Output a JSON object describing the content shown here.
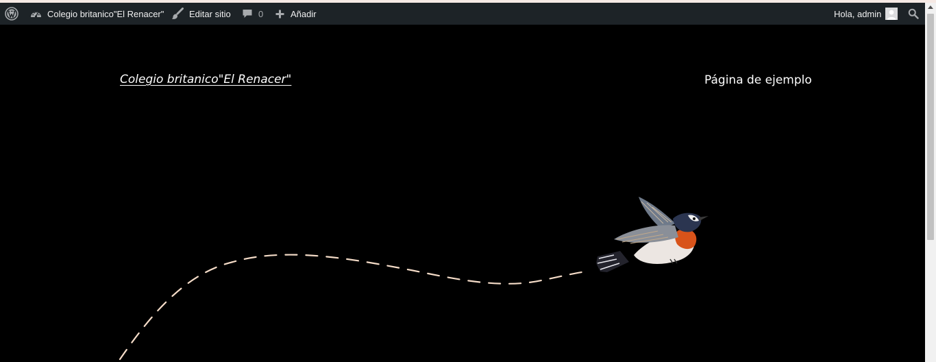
{
  "adminbar": {
    "site_name": "Colegio britanico\"El Renacer\"",
    "edit_site": "Editar sitio",
    "comments_count": "0",
    "add_new": "Añadir",
    "greeting": "Hola, admin",
    "icons": {
      "wordpress": "wordpress-logo-icon",
      "dashboard": "dashboard-gauge-icon",
      "edit": "brush-icon",
      "comments": "comment-bubble-icon",
      "add": "plus-icon",
      "search": "search-icon"
    },
    "colors": {
      "background": "#1d2327",
      "text": "#f0f0f1",
      "muted": "#a7aaad"
    }
  },
  "site": {
    "title": "Colegio britanico\"El Renacer\"",
    "nav": [
      "Página de ejemplo"
    ],
    "background": "#000000",
    "path_color": "#f5dcc8"
  }
}
